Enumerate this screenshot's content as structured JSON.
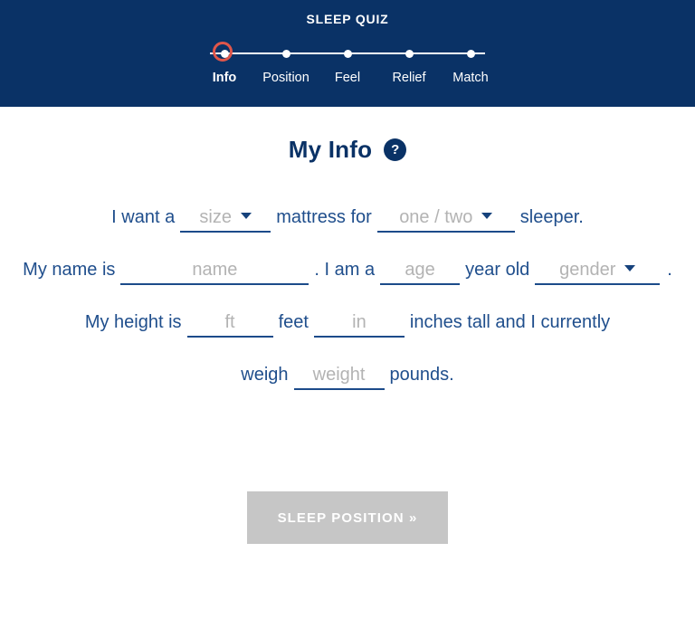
{
  "header": {
    "title": "SLEEP QUIZ",
    "background_color": "#0a3266",
    "accent_color": "#e0564a",
    "steps": [
      {
        "label": "Info",
        "state": "active"
      },
      {
        "label": "Position",
        "state": "upcoming"
      },
      {
        "label": "Feel",
        "state": "upcoming"
      },
      {
        "label": "Relief",
        "state": "upcoming"
      },
      {
        "label": "Match",
        "state": "upcoming"
      }
    ]
  },
  "main": {
    "page_title": "My Info",
    "help_icon": "question-mark-icon",
    "help_icon_label": "?",
    "text_color": "#1f4e8c",
    "lines": {
      "line1": {
        "before": "I want a",
        "middle": "mattress for",
        "after": "sleeper."
      },
      "line2": {
        "before": "My name is",
        "after_name": ". I am a",
        "after_age": "year old",
        "end": "."
      },
      "line3": {
        "before": "My height is",
        "after_ft": "feet",
        "after_in": "inches tall and I currently"
      },
      "line4": {
        "before": "weigh",
        "after": "pounds."
      }
    },
    "fields": {
      "size": {
        "placeholder": "size",
        "value": "",
        "type": "select"
      },
      "sleeper_count": {
        "placeholder": "one / two",
        "value": "",
        "type": "select"
      },
      "name": {
        "placeholder": "name",
        "value": "",
        "type": "text"
      },
      "age": {
        "placeholder": "age",
        "value": "",
        "type": "text"
      },
      "gender": {
        "placeholder": "gender",
        "value": "",
        "type": "select"
      },
      "height_feet": {
        "placeholder": "ft",
        "value": "",
        "type": "text"
      },
      "height_inches": {
        "placeholder": "in",
        "value": "",
        "type": "text"
      },
      "weight": {
        "placeholder": "weight",
        "value": "",
        "type": "text"
      }
    }
  },
  "footer": {
    "next_button_label": "SLEEP POSITION »",
    "next_button_color": "#c6c6c6"
  }
}
